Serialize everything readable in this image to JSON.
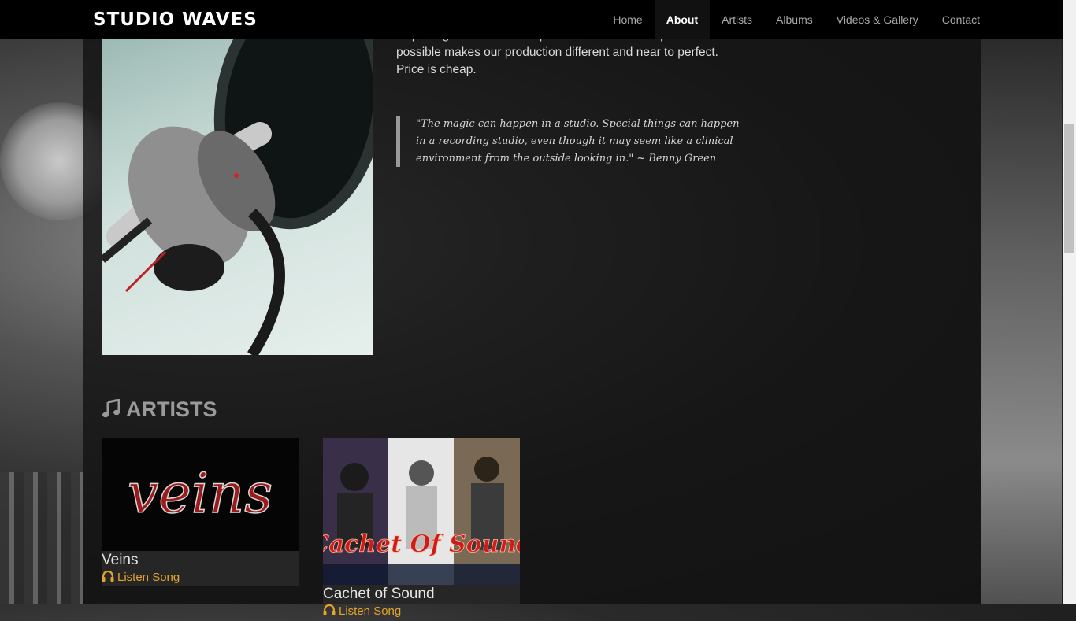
{
  "brand": "STUDIO WAVES",
  "nav": [
    {
      "label": "Home",
      "active": false
    },
    {
      "label": "About",
      "active": true
    },
    {
      "label": "Artists",
      "active": false
    },
    {
      "label": "Albums",
      "active": false
    },
    {
      "label": "Videos & Gallery",
      "active": false
    },
    {
      "label": "Contact",
      "active": false
    }
  ],
  "about": {
    "paragraph": "Capturing noise as low as possible and takes as perfect as possible makes our production different and near to perfect. Price is cheap.",
    "quote": "\"The magic can happen in a studio. Special things can happen in a recording studio, even though it may seem like a clinical environment from the outside looking in.\" ~ Benny Green"
  },
  "artists": {
    "title": "ARTISTS",
    "items": [
      {
        "name": "Veins",
        "listen_label": "Listen Song",
        "logo_text": "veins"
      },
      {
        "name": "Cachet of Sound",
        "listen_label": "Listen Song",
        "logo_text": "Cachet Of Sound"
      }
    ]
  },
  "colors": {
    "accent": "#e5a52a",
    "navbar": "#000000"
  },
  "icons": {
    "section": "music-note-icon",
    "listen": "headphones-icon"
  }
}
